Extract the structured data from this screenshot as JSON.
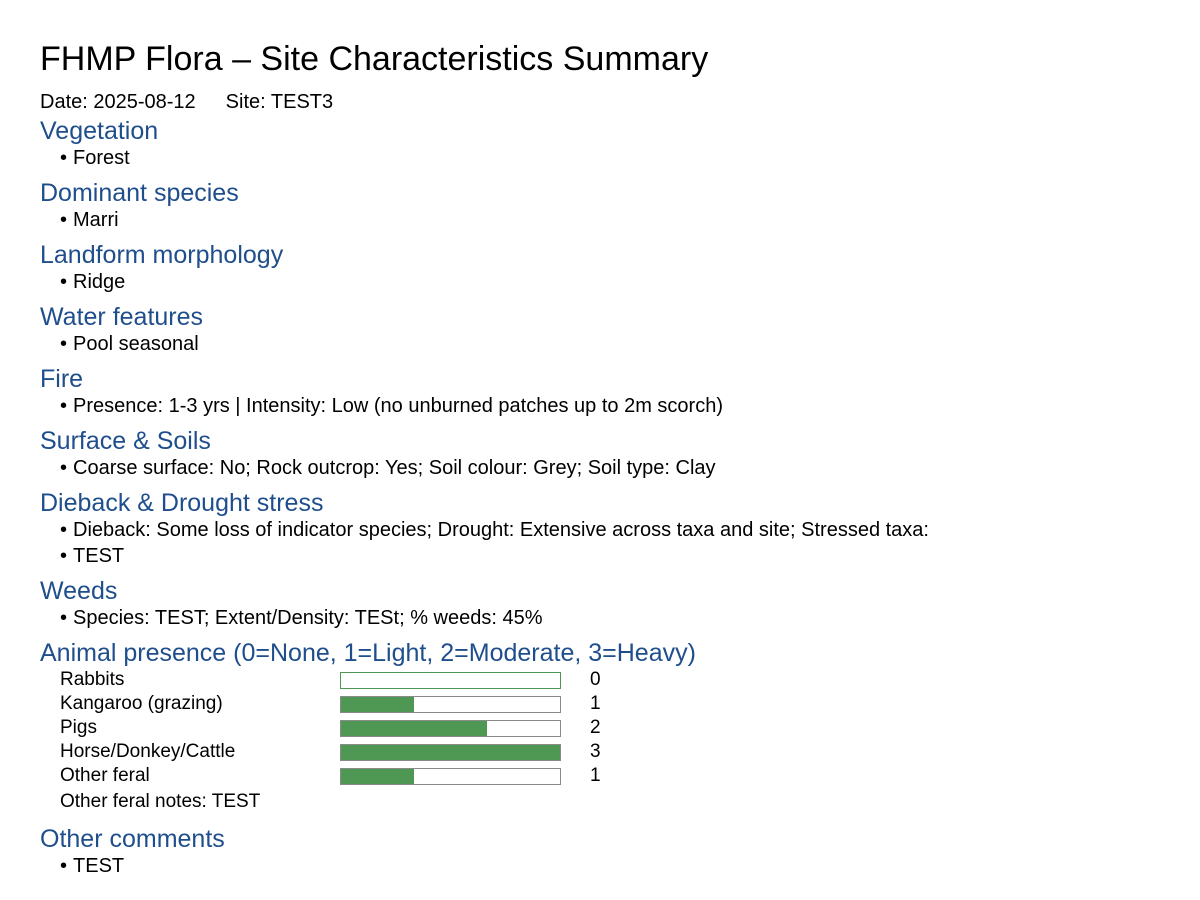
{
  "title": "FHMP Flora – Site Characteristics Summary",
  "meta": {
    "date": "Date: 2025-08-12",
    "site": "Site: TEST3"
  },
  "colors": {
    "heading": "#1f4e8c",
    "bar_fill": "#4e9853"
  },
  "bullet_symbol": "•",
  "sections": {
    "vegetation": {
      "heading": "Vegetation",
      "items": [
        "Forest"
      ]
    },
    "dominant_species": {
      "heading": "Dominant species",
      "items": [
        "Marri"
      ]
    },
    "landform": {
      "heading": "Landform morphology",
      "items": [
        "Ridge"
      ]
    },
    "water": {
      "heading": "Water features",
      "items": [
        "Pool seasonal"
      ]
    },
    "fire": {
      "heading": "Fire",
      "items": [
        "Presence: 1-3 yrs | Intensity: Low (no unburned patches up to 2m scorch)"
      ]
    },
    "soils": {
      "heading": "Surface & Soils",
      "items": [
        "Coarse surface: No; Rock outcrop: Yes; Soil colour: Grey; Soil type: Clay"
      ]
    },
    "dieback": {
      "heading": "Dieback & Drought stress",
      "items": [
        "Dieback: Some loss of indicator species; Drought: Extensive across taxa and site; Stressed taxa:",
        "TEST"
      ]
    },
    "weeds": {
      "heading": "Weeds",
      "items": [
        "Species: TEST; Extent/Density: TESt; % weeds: 45%"
      ]
    },
    "animals": {
      "heading": "Animal presence (0=None, 1=Light, 2=Moderate, 3=Heavy)",
      "scale_max": 3,
      "rows": [
        {
          "name": "Rabbits",
          "value": 0
        },
        {
          "name": "Kangaroo (grazing)",
          "value": 1
        },
        {
          "name": "Pigs",
          "value": 2
        },
        {
          "name": "Horse/Donkey/Cattle",
          "value": 3
        },
        {
          "name": "Other feral",
          "value": 1
        }
      ],
      "notes": "Other feral notes: TEST"
    },
    "comments": {
      "heading": "Other comments",
      "items": [
        "TEST"
      ]
    }
  }
}
